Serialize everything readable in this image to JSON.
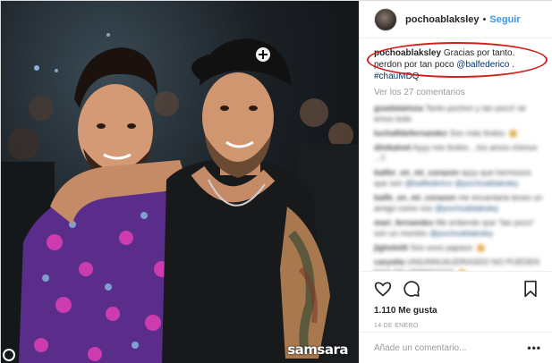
{
  "photo": {
    "alt": "",
    "watermark": "samsara"
  },
  "header": {
    "username": "pochoablaksley",
    "separator": "•",
    "follow_label": "Seguir"
  },
  "caption": {
    "username": "pochoablaksley",
    "text_1": "Gracias por tanto. perdon por tan poco",
    "mention": "@balfederico",
    "sep": " . ",
    "hashtag": "#chauMDQ"
  },
  "view_comments": "Ver los 27 comentarios",
  "comments": [
    {
      "user": "guadalaimoa",
      "text": "Tanto pochon y tan poco! se emos todo"
    },
    {
      "user": "luchafldefernandez",
      "text": "Son más lindos"
    },
    {
      "user": "dimkalvet",
      "text": "Ayyy mis lindos ...los amos chimus ...!!"
    },
    {
      "user": "balfer_en_mi_corazon",
      "text": "ayyy que hermosos que son",
      "mentions": "@balfederico @pochoablaksley"
    },
    {
      "user": "balfe_en_mi_corazon",
      "text": "me encantaria tenes un amigo como vos",
      "mentions": "@pochoablaksley"
    },
    {
      "user": "mari_fernandez",
      "text": "Me entiendo que \"tan poco\" son un montón",
      "mentions": "@pochoablaksley"
    },
    {
      "user": "jlgholoitt",
      "text": "Sos unos papaso"
    },
    {
      "user": "caryolia",
      "text": "UNIUNNUAUDRASDO NO PUEDEN MAS DE HERMOSOS"
    }
  ],
  "actions": {
    "like_icon": "heart-icon",
    "comment_icon": "speech-bubble-icon",
    "save_icon": "bookmark-icon",
    "likes": "1.110 Me gusta",
    "date": "14 de enero"
  },
  "add_comment": {
    "placeholder": "Añade un comentario...",
    "more": "•••"
  },
  "colors": {
    "accent": "#3897f0",
    "circle": "#d0201c",
    "mention": "#003569"
  }
}
